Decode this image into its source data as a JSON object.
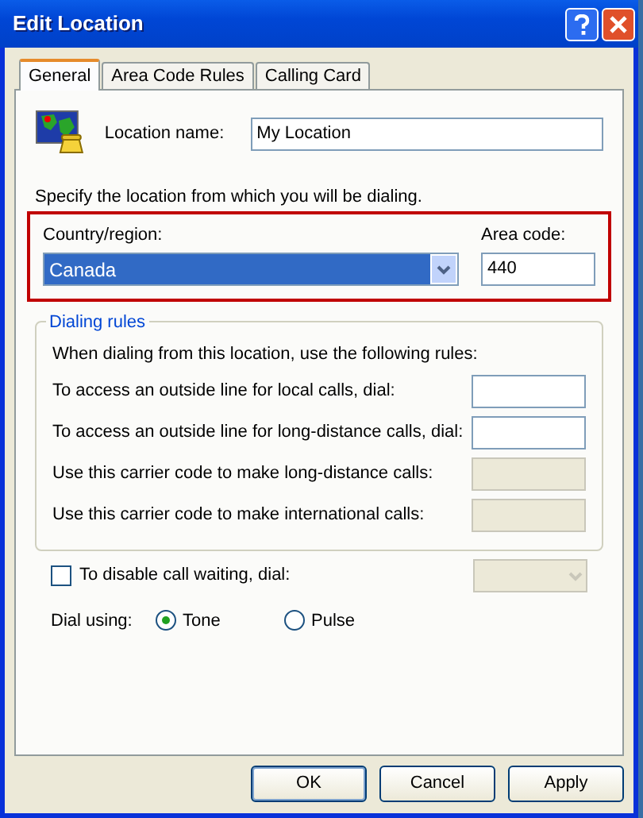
{
  "window": {
    "title": "Edit Location"
  },
  "tabs": [
    {
      "label": "General",
      "selected": true
    },
    {
      "label": "Area Code Rules",
      "selected": false
    },
    {
      "label": "Calling Card",
      "selected": false
    }
  ],
  "location_name": {
    "label": "Location name:",
    "value": "My Location"
  },
  "instruction": "Specify the location from which you will be dialing.",
  "location_group": {
    "highlighted": true,
    "country": {
      "label": "Country/region:",
      "value": "Canada"
    },
    "area_code": {
      "label": "Area code:",
      "value": "440"
    }
  },
  "dialing_rules": {
    "title": "Dialing rules",
    "intro": "When dialing from this location, use the following rules:",
    "rules": [
      {
        "label": "To access an outside line for local calls, dial:",
        "disabled": false
      },
      {
        "label": "To access an outside line for long-distance calls, dial:",
        "disabled": false
      },
      {
        "label": "Use this carrier code to make long-distance calls:",
        "disabled": true
      },
      {
        "label": "Use this carrier code to make international calls:",
        "disabled": true
      }
    ]
  },
  "call_waiting": {
    "label": "To disable call waiting, dial:",
    "checked": false
  },
  "dial_using": {
    "label": "Dial using:",
    "options": [
      {
        "label": "Tone",
        "selected": true
      },
      {
        "label": "Pulse",
        "selected": false
      }
    ]
  },
  "buttons": [
    "OK",
    "Cancel",
    "Apply"
  ]
}
